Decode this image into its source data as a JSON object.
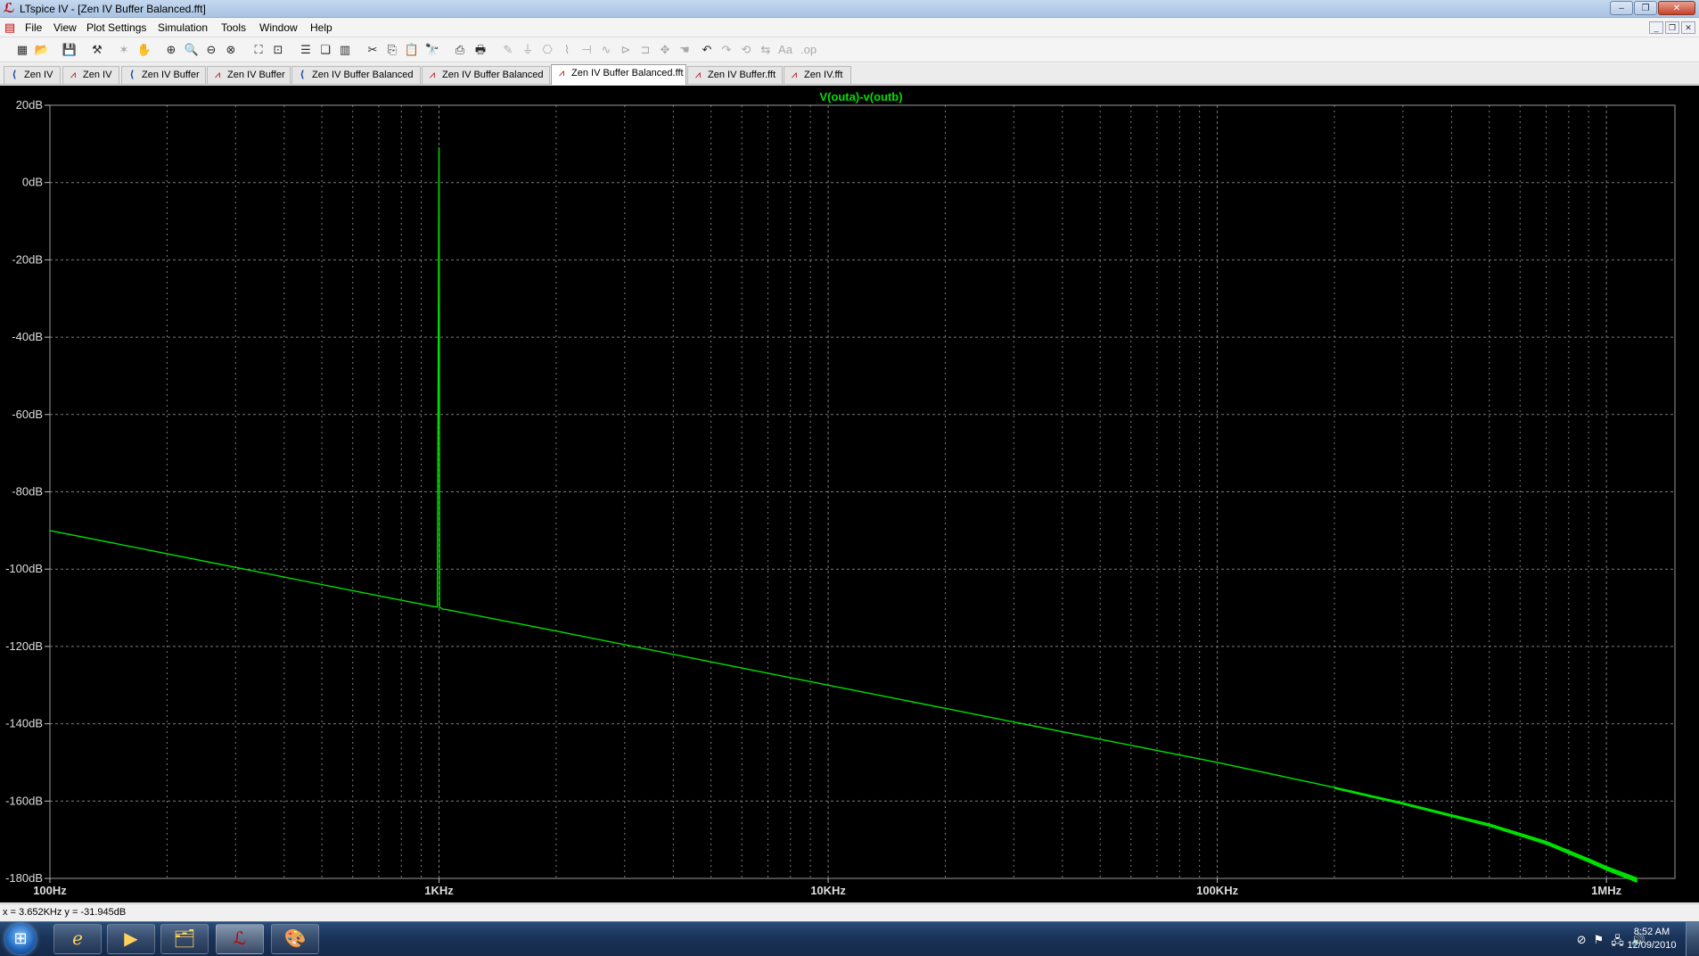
{
  "window": {
    "title": "LTspice IV - [Zen IV Buffer Balanced.fft]",
    "minimize": "–",
    "maximize": "❐",
    "close": "✕"
  },
  "menu": {
    "items": [
      "File",
      "View",
      "Plot Settings",
      "Simulation",
      "Tools",
      "Window",
      "Help"
    ],
    "mdi_minimize": "_",
    "mdi_restore": "❐",
    "mdi_close": "✕"
  },
  "toolbar": {
    "buttons": [
      {
        "icon": "new-plot-icon",
        "glyph": "▦",
        "enabled": true
      },
      {
        "icon": "open-icon",
        "glyph": "📂",
        "enabled": true
      },
      {
        "icon": "save-icon",
        "glyph": "💾",
        "enabled": true
      },
      {
        "icon": "control-panel-icon",
        "glyph": "⚒",
        "enabled": true
      },
      {
        "icon": "run-icon",
        "glyph": "✶",
        "enabled": false
      },
      {
        "icon": "pan-icon",
        "glyph": "✋",
        "enabled": false
      },
      {
        "icon": "zoom-in-icon",
        "glyph": "⊕",
        "enabled": true
      },
      {
        "icon": "zoom-area-icon",
        "glyph": "🔍",
        "enabled": true
      },
      {
        "icon": "zoom-out-icon",
        "glyph": "⊖",
        "enabled": true
      },
      {
        "icon": "zoom-cancel-icon",
        "glyph": "⊗",
        "enabled": true
      },
      {
        "icon": "autoscale-icon",
        "glyph": "⛶",
        "enabled": true
      },
      {
        "icon": "zoom-full-icon",
        "glyph": "⊡",
        "enabled": true
      },
      {
        "icon": "tile-horizontal-icon",
        "glyph": "☰",
        "enabled": true
      },
      {
        "icon": "cascade-icon",
        "glyph": "❏",
        "enabled": true
      },
      {
        "icon": "tile-vertical-icon",
        "glyph": "▥",
        "enabled": true
      },
      {
        "icon": "cut-icon",
        "glyph": "✂",
        "enabled": true
      },
      {
        "icon": "copy-icon",
        "glyph": "⎘",
        "enabled": true
      },
      {
        "icon": "paste-icon",
        "glyph": "📋",
        "enabled": false
      },
      {
        "icon": "find-icon",
        "glyph": "🔭",
        "enabled": true
      },
      {
        "icon": "print-preview-icon",
        "glyph": "⎙",
        "enabled": true
      },
      {
        "icon": "print-icon",
        "glyph": "🖶",
        "enabled": true
      },
      {
        "icon": "wire-icon",
        "glyph": "✎",
        "enabled": false
      },
      {
        "icon": "ground-icon",
        "glyph": "⏚",
        "enabled": false
      },
      {
        "icon": "label-net-icon",
        "glyph": "⎔",
        "enabled": false
      },
      {
        "icon": "resistor-icon",
        "glyph": "⌇",
        "enabled": false
      },
      {
        "icon": "capacitor-icon",
        "glyph": "⊣",
        "enabled": false
      },
      {
        "icon": "inductor-icon",
        "glyph": "∿",
        "enabled": false
      },
      {
        "icon": "diode-icon",
        "glyph": "⊳",
        "enabled": false
      },
      {
        "icon": "component-icon",
        "glyph": "⊐",
        "enabled": false
      },
      {
        "icon": "move-icon",
        "glyph": "✥",
        "enabled": false
      },
      {
        "icon": "drag-icon",
        "glyph": "☚",
        "enabled": false
      },
      {
        "icon": "undo-icon",
        "glyph": "↶",
        "enabled": true
      },
      {
        "icon": "redo-icon",
        "glyph": "↷",
        "enabled": false
      },
      {
        "icon": "rotate-icon",
        "glyph": "⟲",
        "enabled": false
      },
      {
        "icon": "mirror-icon",
        "glyph": "⇆",
        "enabled": false
      },
      {
        "icon": "text-icon",
        "glyph": "Aa",
        "enabled": false
      },
      {
        "icon": "spice-directive-icon",
        "glyph": ".op",
        "enabled": false
      }
    ]
  },
  "tabs": [
    {
      "label": "Zen IV",
      "kind": "schematic",
      "active": false
    },
    {
      "label": "Zen IV",
      "kind": "plot",
      "active": false
    },
    {
      "label": "Zen IV Buffer",
      "kind": "schematic",
      "active": false
    },
    {
      "label": "Zen IV Buffer",
      "kind": "plot",
      "active": false
    },
    {
      "label": "Zen IV Buffer Balanced",
      "kind": "schematic",
      "active": false
    },
    {
      "label": "Zen IV Buffer Balanced",
      "kind": "plot",
      "active": false
    },
    {
      "label": "Zen IV Buffer Balanced.fft",
      "kind": "plot",
      "active": true
    },
    {
      "label": "Zen IV Buffer.fft",
      "kind": "plot",
      "active": false
    },
    {
      "label": "Zen IV.fft",
      "kind": "plot",
      "active": false
    }
  ],
  "chart_data": {
    "type": "line",
    "title": "",
    "xlabel": "",
    "ylabel": "",
    "xscale": "log",
    "xlim": [
      100,
      1500000
    ],
    "ylim": [
      -180,
      20
    ],
    "x_ticks": [
      {
        "value": 100,
        "label": "100Hz"
      },
      {
        "value": 1000,
        "label": "1KHz"
      },
      {
        "value": 10000,
        "label": "10KHz"
      },
      {
        "value": 100000,
        "label": "100KHz"
      },
      {
        "value": 1000000,
        "label": "1MHz"
      }
    ],
    "y_ticks": [
      {
        "value": 20,
        "label": "20dB"
      },
      {
        "value": 0,
        "label": "0dB"
      },
      {
        "value": -20,
        "label": "-20dB"
      },
      {
        "value": -40,
        "label": "-40dB"
      },
      {
        "value": -60,
        "label": "-60dB"
      },
      {
        "value": -80,
        "label": "-80dB"
      },
      {
        "value": -100,
        "label": "-100dB"
      },
      {
        "value": -120,
        "label": "-120dB"
      },
      {
        "value": -140,
        "label": "-140dB"
      },
      {
        "value": -160,
        "label": "-160dB"
      },
      {
        "value": -180,
        "label": "-180dB"
      }
    ],
    "grid": true,
    "background_color": "#000000",
    "grid_color": "#7a7a7a",
    "tick_label_color": "#dddddd",
    "series": [
      {
        "name": "V(outa)-v(outb)",
        "color": "#00e000",
        "x": [
          100,
          200,
          500,
          950,
          990,
          1000,
          1003,
          1010,
          1020,
          1050,
          2000,
          5000,
          10000,
          20000,
          50000,
          100000,
          200000,
          300000,
          500000,
          700000,
          900000,
          1000000,
          1200000
        ],
        "y": [
          -90,
          -96,
          -104,
          -109.5,
          -109.8,
          9,
          -109.9,
          -110,
          -110.3,
          -110.5,
          -116,
          -124,
          -130,
          -136,
          -144,
          -150,
          -156.5,
          -160.5,
          -166,
          -170.5,
          -175,
          -177,
          -180
        ]
      }
    ]
  },
  "status": {
    "cursor_readout": "x = 3.652KHz    y = -31.945dB"
  },
  "taskbar": {
    "start_glyph": "⊞",
    "apps": [
      {
        "icon": "internet-explorer-icon",
        "glyph": "ℯ",
        "active": false
      },
      {
        "icon": "media-player-icon",
        "glyph": "▶",
        "active": false
      },
      {
        "icon": "file-explorer-icon",
        "glyph": "🗂",
        "active": false
      },
      {
        "icon": "ltspice-icon",
        "glyph": "ℒ",
        "active": true
      },
      {
        "icon": "paint-icon",
        "glyph": "🎨",
        "active": false
      }
    ],
    "tray": [
      {
        "icon": "antivirus-icon",
        "glyph": "⊘"
      },
      {
        "icon": "action-center-flag-icon",
        "glyph": "⚑"
      },
      {
        "icon": "network-icon",
        "glyph": "🖧"
      },
      {
        "icon": "volume-icon",
        "glyph": "🔊"
      }
    ],
    "time": "8:52 AM",
    "date": "12/09/2010"
  }
}
